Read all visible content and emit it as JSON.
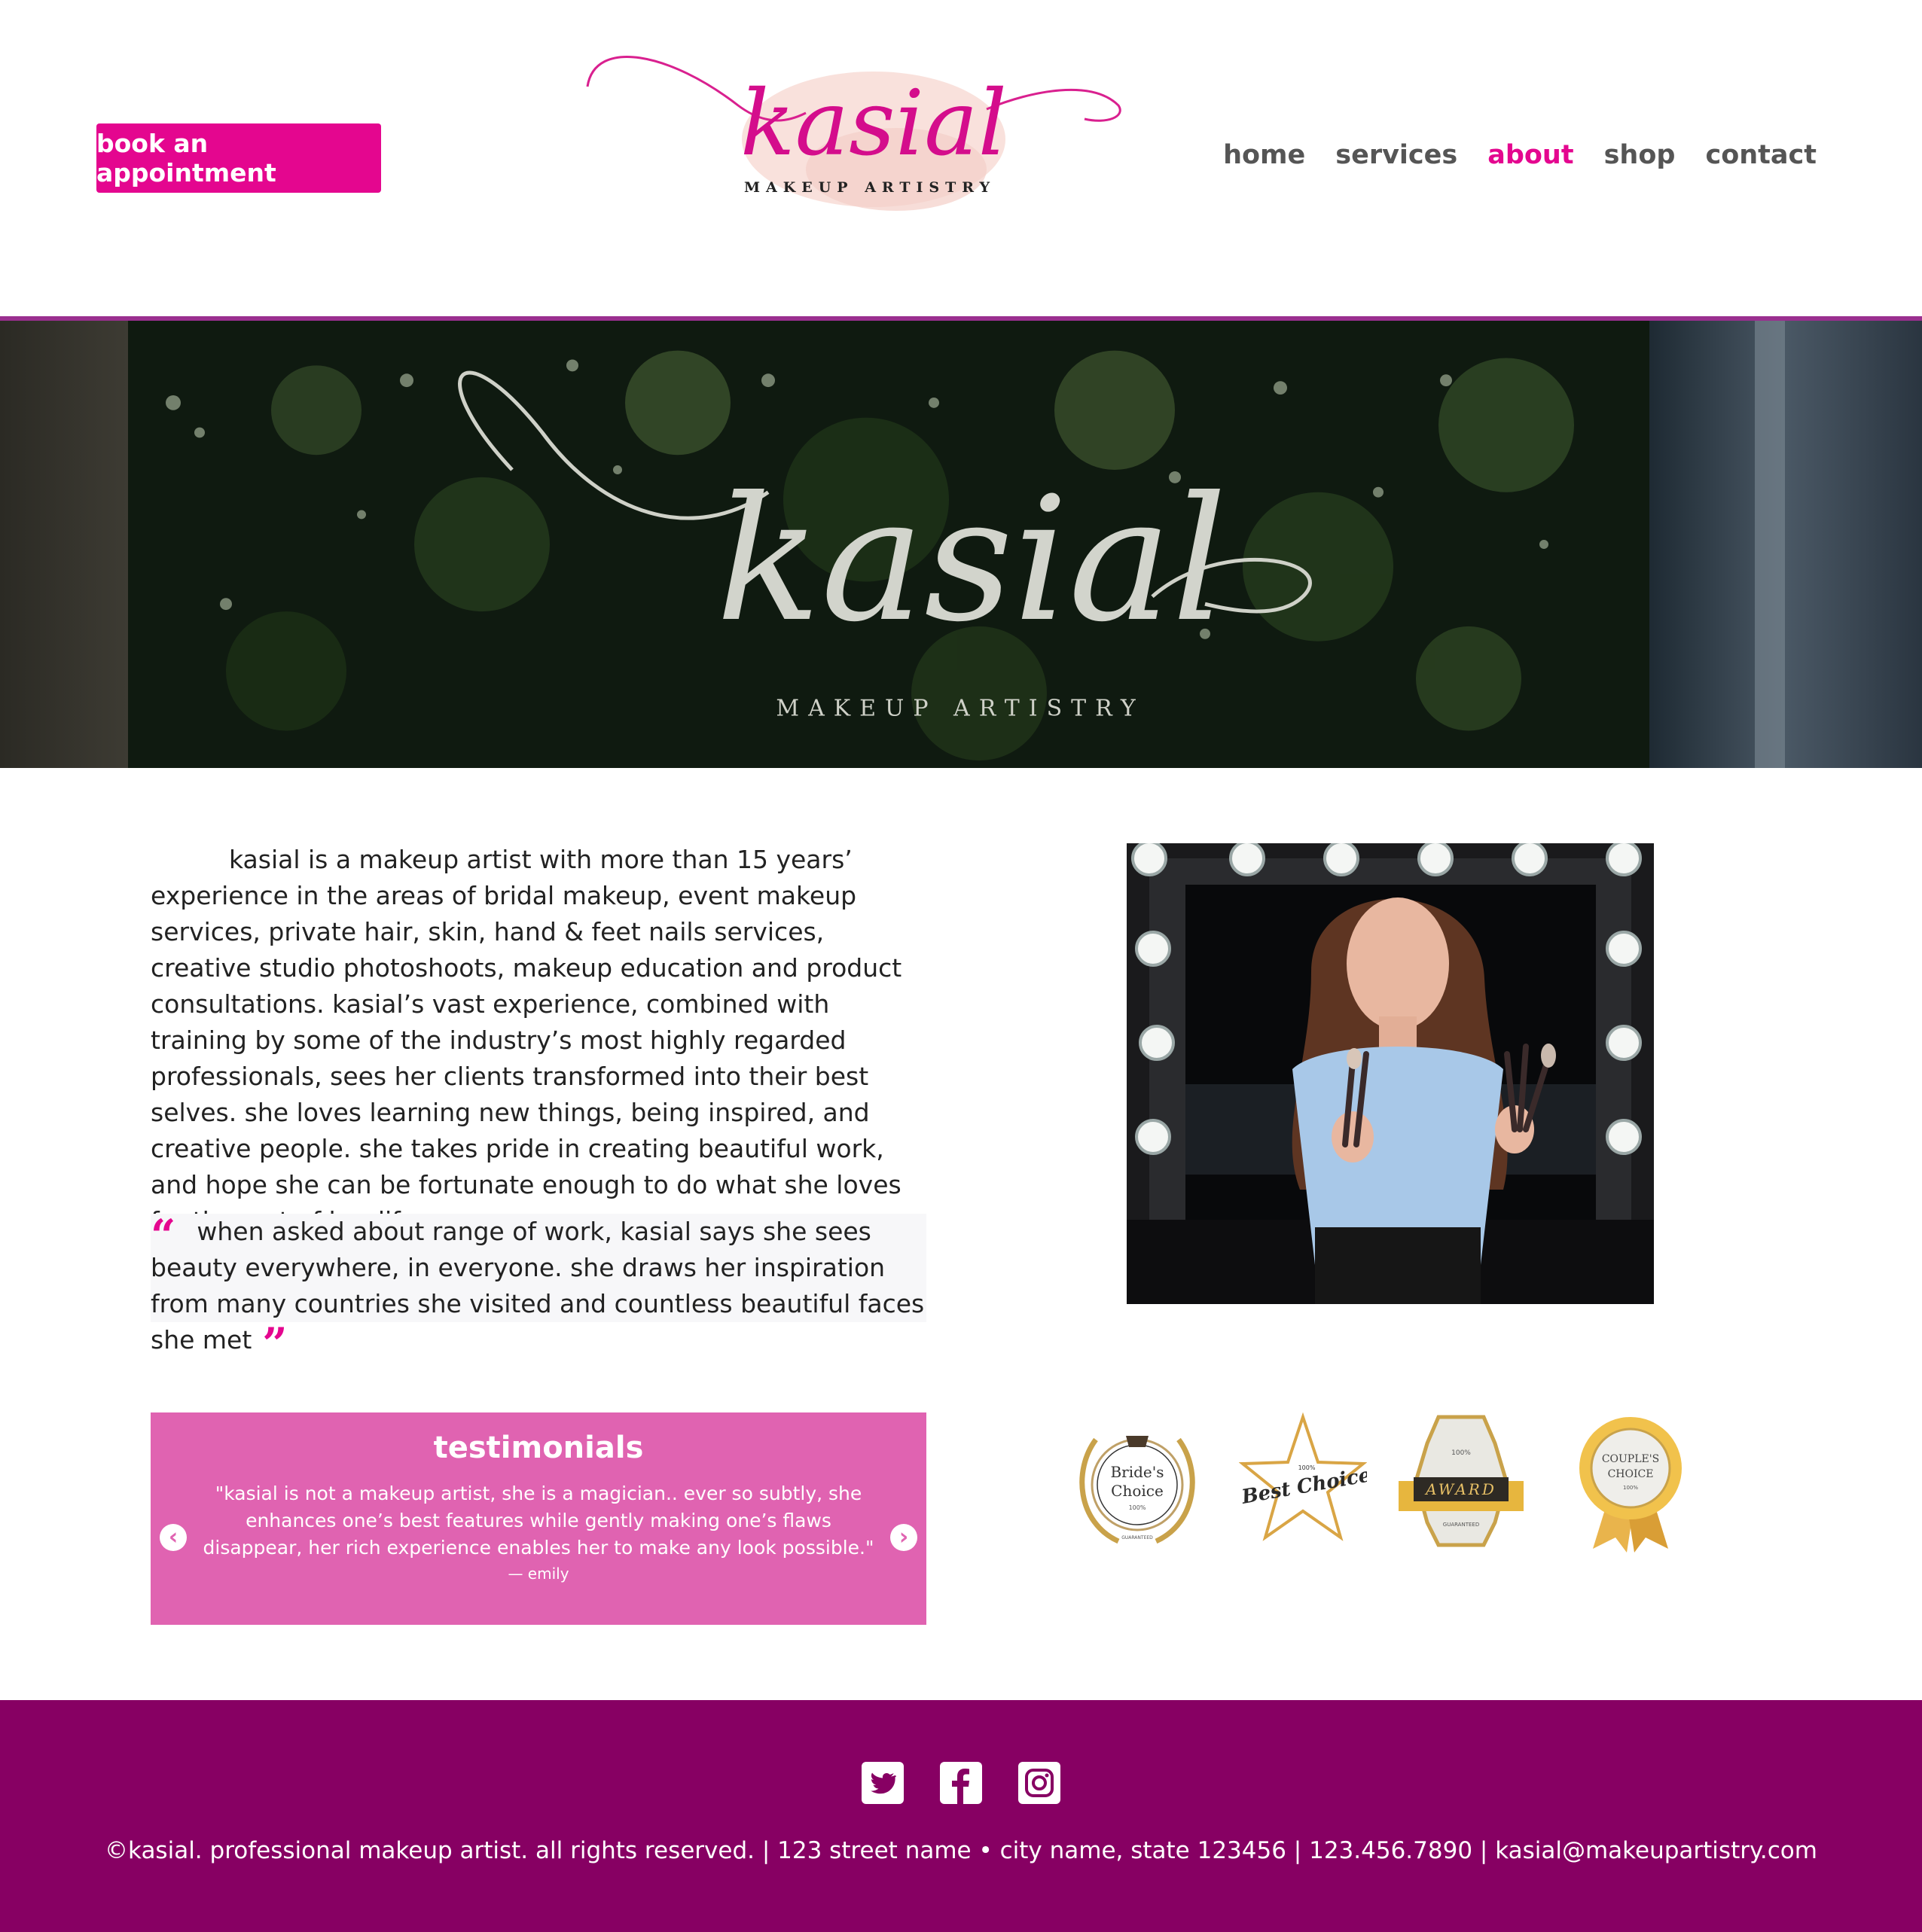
{
  "header": {
    "book_label": "book an appointment",
    "logo_script": "kasial",
    "logo_subtitle": "MAKEUP ARTISTRY",
    "nav": [
      {
        "label": "home",
        "active": false
      },
      {
        "label": "services",
        "active": false
      },
      {
        "label": "about",
        "active": true
      },
      {
        "label": "shop",
        "active": false
      },
      {
        "label": "contact",
        "active": false
      }
    ]
  },
  "hero": {
    "script": "kasial",
    "subtitle": "MAKEUP ARTISTRY"
  },
  "main": {
    "bio": "kasial is a makeup artist with more than 15 years’ experience in the areas of bridal makeup, event makeup services, private hair, skin, hand & feet nails services, creative studio photoshoots, makeup education and product consultations. kasial’s vast experience, combined with training by some of the industry’s most highly regarded professionals, sees her clients transformed into their best selves. she loves learning new things, being inspired, and creative people. she takes pride in creating beautiful work, and hope she can be fortunate enough to do what she loves for the rest of her life.",
    "quote": "when asked about range of work, kasial says she sees beauty everywhere, in everyone. she draws her inspiration from many countries she visited and countless beautiful faces she met",
    "quote_open": "“",
    "quote_close": "”"
  },
  "testimonials": {
    "title": "testimonials",
    "text": "\"kasial is not a makeup artist, she is a magician.. ever so subtly, she enhances one’s best features while gently making one’s flaws disappear, her rich experience enables her to make any look possible.\"",
    "author": "— emily",
    "prev_icon": "‹",
    "next_icon": "›"
  },
  "badges": {
    "brides_line1": "Bride's",
    "brides_line2": "Choice",
    "brides_pct": "100%",
    "brides_guarantee": "GUARANTEED",
    "best_top": "100%",
    "best_text": "Best Choice",
    "award_top": "100%",
    "award_text": "AWARD",
    "award_bottom": "GUARANTEED",
    "couples_line1": "COUPLE'S",
    "couples_line2": "CHOICE",
    "couples_pct": "100%"
  },
  "footer": {
    "text": "©kasial. professional makeup artist. all rights reserved. | 123 street name • city name, state 123456 | 123.456.7890 | kasial@makeupartistry.com",
    "social_icons": [
      "twitter-icon",
      "facebook-icon",
      "instagram-icon"
    ]
  },
  "colors": {
    "accent": "#e4068f",
    "testimonial_bg": "#e063b1",
    "footer_bg": "#870063"
  }
}
